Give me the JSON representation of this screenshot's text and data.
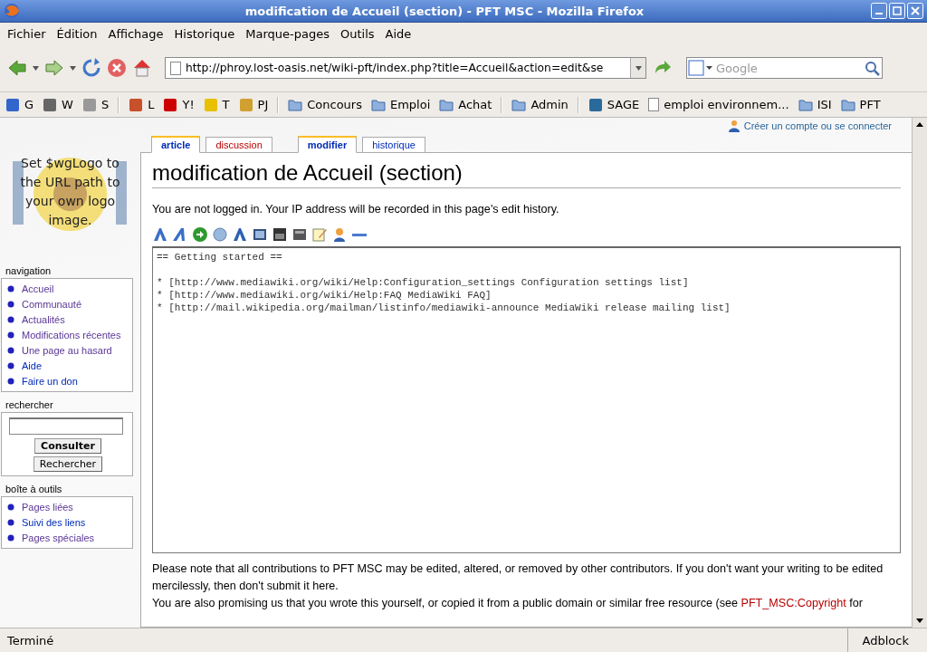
{
  "window": {
    "title": "modification de Accueil (section) - PFT MSC - Mozilla Firefox"
  },
  "menu": [
    "Fichier",
    "Édition",
    "Affichage",
    "Historique",
    "Marque-pages",
    "Outils",
    "Aide"
  ],
  "address_bar": {
    "value": "http://phroy.lost-oasis.net/wiki-pft/index.php?title=Accueil&action=edit&se"
  },
  "search_bar": {
    "placeholder": "Google"
  },
  "bookmarks": [
    {
      "kind": "site",
      "label": "G",
      "color": "#3366cc"
    },
    {
      "kind": "site",
      "label": "W",
      "color": "#666666"
    },
    {
      "kind": "site",
      "label": "S",
      "color": "#999999"
    },
    {
      "kind": "separator"
    },
    {
      "kind": "site",
      "label": "L",
      "color": "#c8502a"
    },
    {
      "kind": "site",
      "label": "Y!",
      "color": "#cc0000"
    },
    {
      "kind": "site",
      "label": "T",
      "color": "#e8c000"
    },
    {
      "kind": "site",
      "label": "PJ",
      "color": "#d0a030"
    },
    {
      "kind": "separator"
    },
    {
      "kind": "folder",
      "label": "Concours"
    },
    {
      "kind": "folder",
      "label": "Emploi"
    },
    {
      "kind": "folder",
      "label": "Achat"
    },
    {
      "kind": "separator"
    },
    {
      "kind": "folder",
      "label": "Admin"
    },
    {
      "kind": "separator"
    },
    {
      "kind": "site",
      "label": "SAGE",
      "color": "#2a6a9a"
    },
    {
      "kind": "page",
      "label": "emploi environnem..."
    },
    {
      "kind": "folder",
      "label": "ISI"
    },
    {
      "kind": "folder",
      "label": "PFT"
    }
  ],
  "logo": {
    "text": "Set $wgLogo to the URL path to your own logo image."
  },
  "personal": {
    "link": "Créer un compte ou se connecter"
  },
  "tabs": [
    {
      "label": "article",
      "selected": true,
      "new": false
    },
    {
      "label": "discussion",
      "selected": false,
      "new": true
    },
    {
      "label": "modifier",
      "selected": true,
      "new": false
    },
    {
      "label": "historique",
      "selected": false,
      "new": false
    }
  ],
  "sidebar": [
    {
      "kind": "links",
      "title": "navigation",
      "items": [
        {
          "label": "Accueil",
          "visited": true
        },
        {
          "label": "Communauté",
          "visited": true
        },
        {
          "label": "Actualités",
          "visited": true
        },
        {
          "label": "Modifications récentes",
          "visited": true
        },
        {
          "label": "Une page au hasard",
          "visited": true
        },
        {
          "label": "Aide",
          "visited": false
        },
        {
          "label": "Faire un don",
          "visited": false
        }
      ]
    },
    {
      "kind": "search",
      "title": "rechercher",
      "buttons": [
        "Consulter",
        "Rechercher"
      ]
    },
    {
      "kind": "links",
      "title": "boîte à outils",
      "items": [
        {
          "label": "Pages liées",
          "visited": true
        },
        {
          "label": "Suivi des liens",
          "visited": false
        },
        {
          "label": "Pages spéciales",
          "visited": true
        }
      ]
    }
  ],
  "page": {
    "heading": "modification de Accueil (section)",
    "notice": "You are not logged in. Your IP address will be recorded in this page's edit history.",
    "editor_text": "== Getting started ==\n\n* [http://www.mediawiki.org/wiki/Help:Configuration_settings Configuration settings list]\n* [http://www.mediawiki.org/wiki/Help:FAQ MediaWiki FAQ]\n* [http://mail.wikipedia.org/mailman/listinfo/mediawiki-announce MediaWiki release mailing list]",
    "note": "Please note that all contributions to PFT MSC may be edited, altered, or removed by other contributors. If you don't want your writing to be edited mercilessly, then don't submit it here.",
    "note2": {
      "text": "You are also promising us that you wrote this yourself, or copied it from a public domain or similar free resource (see",
      "link": "PFT_MSC:Copyright",
      "after": "for"
    }
  },
  "status_bar": {
    "text": "Terminé",
    "addon": "Adblock"
  }
}
